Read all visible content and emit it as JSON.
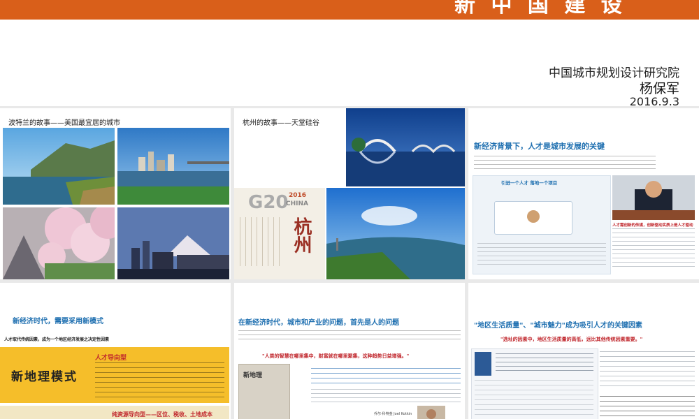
{
  "header": {
    "institute": "中国城市规划设计研究院",
    "author": "杨保军",
    "date": "2016.9.3"
  },
  "slides": [
    {
      "caption": "波特兰的故事——美国最宜居的城市"
    },
    {
      "caption": "杭州的故事——天堂硅谷",
      "g20": "G20",
      "g20_year": "2016",
      "g20_country": "CHINA",
      "hangzhou": "杭州"
    },
    {
      "title": "新经济背景下，人才是城市发展的关键",
      "subtitle": "引进一个人才 落地一个项目",
      "right_label": "人才需创新的传媒，创新驱动实质上是人才驱动"
    },
    {
      "title": "新经济时代，需要采用新模式",
      "subtitle": "人才取代传统因素，成为一个地区经济发展之决定性因素",
      "box_title": "人才导向型",
      "box_banner": "新地理模式",
      "box_bottom": "纯资源导向型——区位、税收、土地成本"
    },
    {
      "title": "在新经济时代，城市和产业的问题，首先是人的问题",
      "quote": "\"人类的智慧在哪里集中，财富就在哪里聚集，这种趋势日益增强。\"",
      "book_title": "新地理",
      "author_name": "乔尔·科特金  Joel Kotkin"
    },
    {
      "title": "\"地区生活质量\"、\"城市魅力\"成为吸引人才的关键因素",
      "quote": "\"选址的因素中，地区生活质量的高低，远比其他传统因素重要。\""
    }
  ]
}
